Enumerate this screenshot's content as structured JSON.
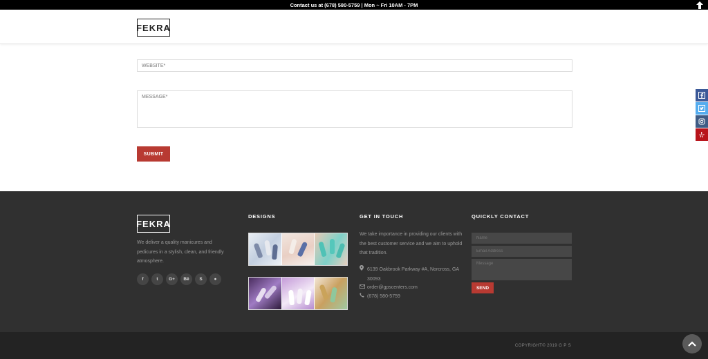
{
  "topbar": {
    "contact_text": "Contact us at (678) 580-5759 | Mon ~ Fri  10AM - 7PM",
    "arrow_icon": "arrow-up-icon"
  },
  "header": {
    "logo": "FEKRA"
  },
  "form": {
    "website_placeholder": "WEBSITE*",
    "message_placeholder": "MESSAGE*",
    "submit_label": "SUBMIT"
  },
  "side_social": [
    "facebook-icon",
    "twitter-icon",
    "instagram-icon",
    "yelp-icon"
  ],
  "footer": {
    "logo": "FEKRA",
    "about": "We deliver a quality manicures and pedicures in a stylish, clean, and friendly atmosphere.",
    "socials": [
      {
        "icon": "facebook-icon",
        "glyph": "f"
      },
      {
        "icon": "twitter-icon",
        "glyph": "t"
      },
      {
        "icon": "google-plus-icon",
        "glyph": "G+"
      },
      {
        "icon": "behance-icon",
        "glyph": "Bē"
      },
      {
        "icon": "skype-icon",
        "glyph": "S"
      },
      {
        "icon": "apple-icon",
        "glyph": "●"
      }
    ],
    "designs_heading": "DESIGNS",
    "touch_heading": "GET IN TOUCH",
    "touch_text": "We take importance in providing our clients with the best customer service and we aim to uphold that tradition.",
    "address": "6139 Oakbrook Parkway #A, Norcross, GA 30093",
    "email": "order@gpscenters.com",
    "phone": "(678) 580-5759",
    "contact_heading": "QUICKLY CONTACT",
    "qc_name_placeholder": "Name",
    "qc_email_placeholder": "Email Address",
    "qc_message_placeholder": "Message",
    "qc_send_label": "SEND"
  },
  "bottombar": {
    "copyright": "COPYRIGHT© 2019  G P S"
  },
  "colors": {
    "accent": "#b83a32",
    "footer_bg": "#303030",
    "bottom_bg": "#232323"
  }
}
